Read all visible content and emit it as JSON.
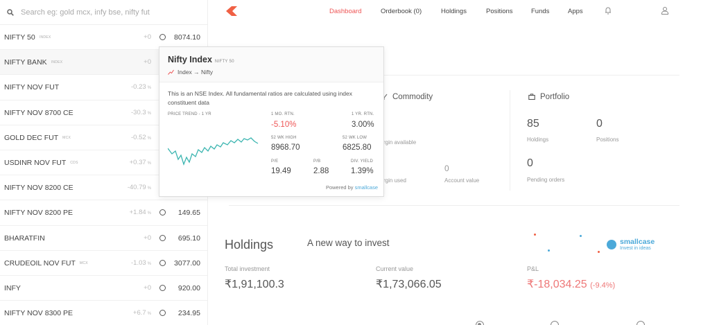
{
  "search": {
    "placeholder": "Search eg: gold mcx, infy bse, nifty fut"
  },
  "watchlist": [
    {
      "name": "NIFTY 50",
      "exchange": "INDEX",
      "change": "+0",
      "unit": "",
      "ltp": "8074.10",
      "highlight": false
    },
    {
      "name": "NIFTY BANK",
      "exchange": "INDEX",
      "change": "+0",
      "unit": "",
      "ltp": "",
      "highlight": true
    },
    {
      "name": "NIFTY NOV FUT",
      "exchange": "",
      "change": "-0.23",
      "unit": "%",
      "ltp": "",
      "highlight": false
    },
    {
      "name": "NIFTY NOV 8700 CE",
      "exchange": "",
      "change": "-30.3",
      "unit": "%",
      "ltp": "",
      "highlight": false
    },
    {
      "name": "GOLD DEC FUT",
      "exchange": "MCX",
      "change": "-0.52",
      "unit": "%",
      "ltp": "",
      "highlight": false
    },
    {
      "name": "USDINR NOV FUT",
      "exchange": "CDS",
      "change": "+0.37",
      "unit": "%",
      "ltp": "",
      "highlight": false
    },
    {
      "name": "NIFTY NOV 8200 CE",
      "exchange": "",
      "change": "-40.79",
      "unit": "%",
      "ltp": "",
      "highlight": false
    },
    {
      "name": "NIFTY NOV 8200 PE",
      "exchange": "",
      "change": "+1.84",
      "unit": "%",
      "ltp": "149.65",
      "highlight": false
    },
    {
      "name": "BHARATFIN",
      "exchange": "",
      "change": "+0",
      "unit": "",
      "ltp": "695.10",
      "highlight": false
    },
    {
      "name": "CRUDEOIL NOV FUT",
      "exchange": "MCX",
      "change": "-1.03",
      "unit": "%",
      "ltp": "3077.00",
      "highlight": false
    },
    {
      "name": "INFY",
      "exchange": "",
      "change": "+0",
      "unit": "",
      "ltp": "920.00",
      "highlight": false
    },
    {
      "name": "NIFTY NOV 8300 PE",
      "exchange": "",
      "change": "+6.7",
      "unit": "%",
      "ltp": "234.95",
      "highlight": false
    }
  ],
  "nav": {
    "dashboard": "Dashboard",
    "orderbook": "Orderbook (0)",
    "holdings": "Holdings",
    "positions": "Positions",
    "funds": "Funds",
    "apps": "Apps",
    "accent": "#e55"
  },
  "commodity": {
    "title": "Commodity",
    "value": ")",
    "margin_available": "rgin available",
    "margin_used": "rgin used",
    "account_value": "0",
    "account_value_label": "Account value"
  },
  "portfolio": {
    "title": "Portfolio",
    "holdings_value": "85",
    "holdings_label": "Holdings",
    "positions_value": "0",
    "positions_label": "Positions",
    "pending_value": "0",
    "pending_label": "Pending orders"
  },
  "holdings": {
    "title": "Holdings",
    "total_investment_label": "Total investment",
    "total_investment": "₹1,91,100.3",
    "current_value_label": "Current value",
    "current_value": "₹1,73,066.05",
    "pnl_label": "P&L",
    "pnl": "₹-18,034.25",
    "pnl_pct": "(-9.4%)"
  },
  "promo": {
    "text": "A new way to invest",
    "brand": "smallcase",
    "tagline": "Invest in ideas"
  },
  "popover": {
    "title": "Nifty Index",
    "subtitle": "NIFTY 50",
    "category": "Index → Nifty",
    "description": "This is an NSE Index. All fundamental ratios are calculated using index constituent data",
    "price_trend_label": "PRICE TREND - 1 YR",
    "ret_1m_label": "1 MO. RTN.",
    "ret_1m": "-5.10%",
    "ret_1y_label": "1 YR. RTN.",
    "ret_1y": "3.00%",
    "wk52_high_label": "52 WK HIGH",
    "wk52_high": "8968.70",
    "wk52_low_label": "52 WK LOW",
    "wk52_low": "6825.80",
    "pe_label": "P/E",
    "pe": "19.49",
    "pb_label": "P/B",
    "pb": "2.88",
    "div_label": "DIV. YIELD",
    "div": "1.39%",
    "powered_by": "Powered by",
    "powered_brand": "smallcase",
    "trend_color": "#3bb5b0"
  },
  "icons": {
    "search": "search-icon",
    "logo": "kite-logo",
    "bell": "bell-icon",
    "user": "user-icon",
    "commodity": "commodity-icon",
    "portfolio": "briefcase-icon"
  }
}
